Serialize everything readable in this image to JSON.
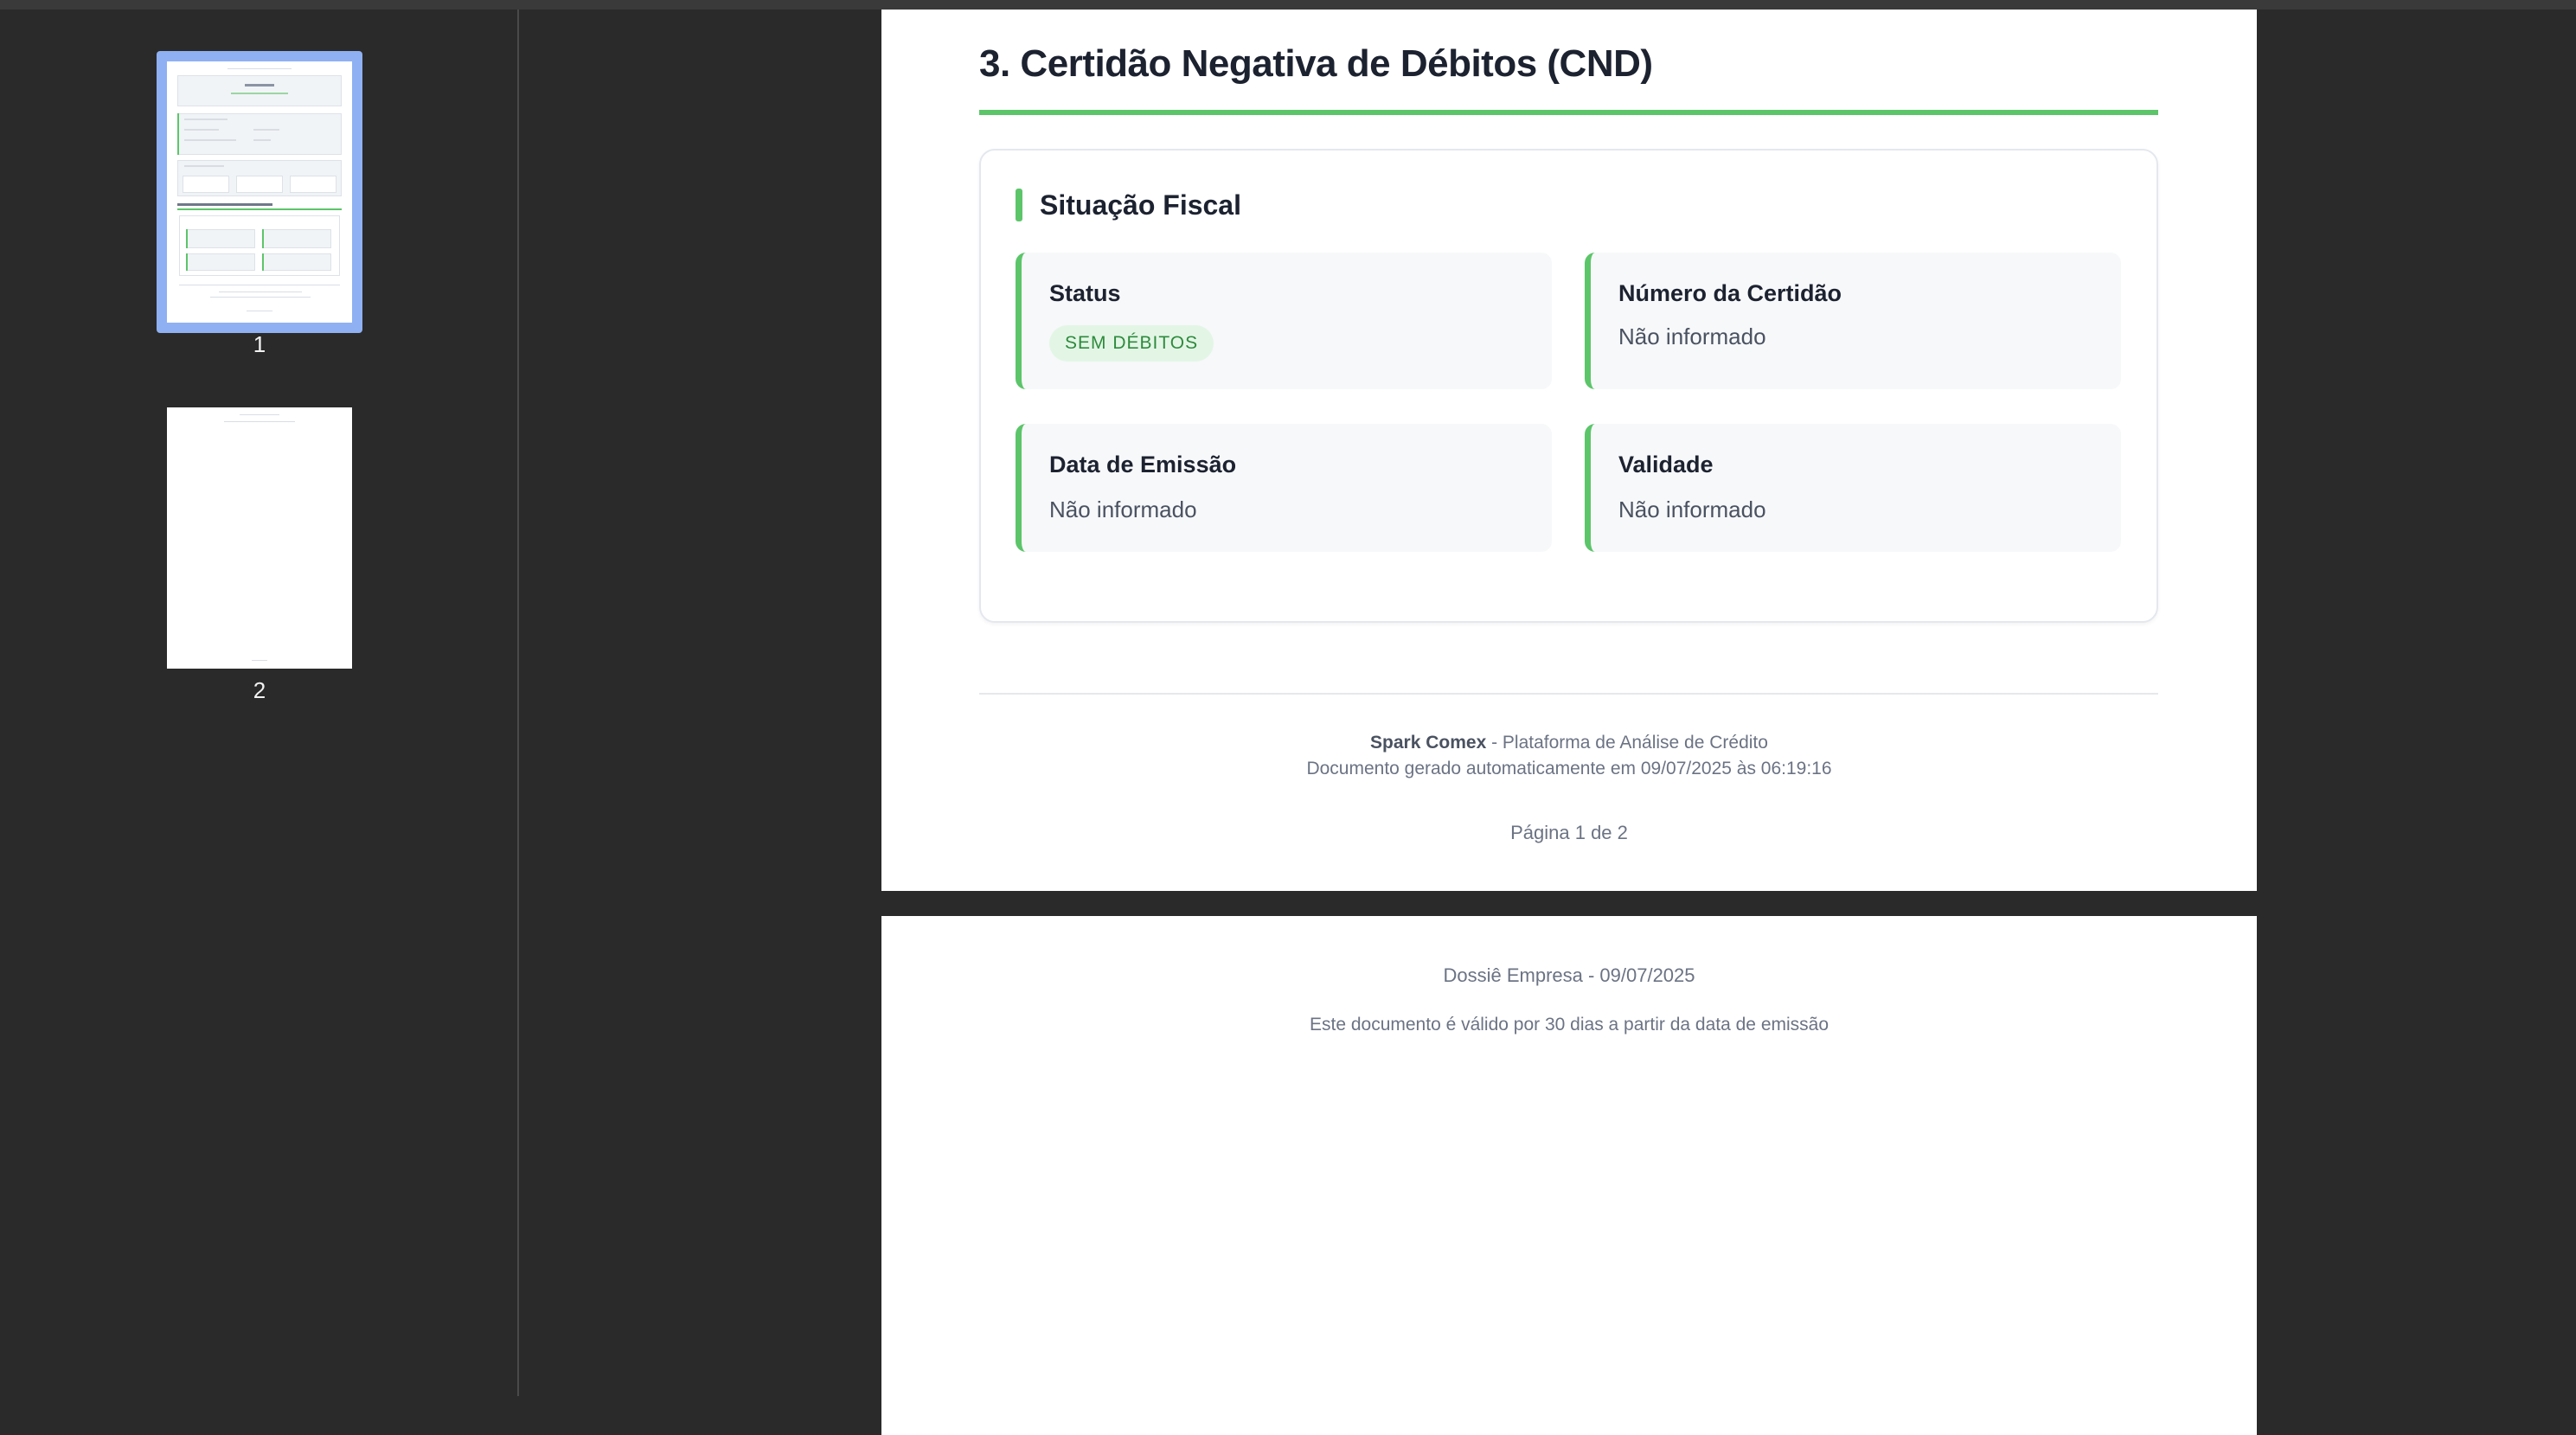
{
  "sidebar": {
    "thumbnails": [
      {
        "label": "1",
        "selected": true
      },
      {
        "label": "2",
        "selected": false
      }
    ]
  },
  "page1": {
    "section_title": "3. Certidão Negativa de Débitos (CND)",
    "card": {
      "title": "Situação Fiscal",
      "fields": {
        "status": {
          "label": "Status",
          "badge": "SEM DÉBITOS"
        },
        "numero": {
          "label": "Número da Certidão",
          "value": "Não informado"
        },
        "emissao": {
          "label": "Data de Emissão",
          "value": "Não informado"
        },
        "validade": {
          "label": "Validade",
          "value": "Não informado"
        }
      }
    },
    "footer": {
      "brand": "Spark Comex",
      "tagline": " - Plataforma de Análise de Crédito",
      "generated": "Documento gerado automaticamente em 09/07/2025 às 06:19:16",
      "page_number": "Página 1 de 2"
    }
  },
  "page2": {
    "header": "Dossiê Empresa - 09/07/2025",
    "note": "Este documento é válido por 30 dias a partir da data de emissão"
  },
  "colors": {
    "accent": "#5cc56a",
    "badge_bg": "#e3f6e6",
    "badge_text": "#2e8a3d",
    "viewer_bg": "#2a2a2a",
    "selection": "#8fb0f2"
  }
}
